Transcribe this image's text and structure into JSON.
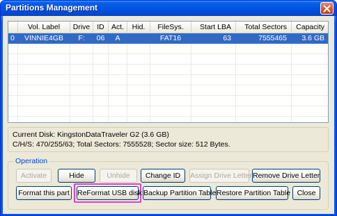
{
  "window": {
    "title": "Partitions Management"
  },
  "table": {
    "columns": [
      "",
      "Vol. Label",
      "Drive",
      "ID",
      "Act.",
      "Hid.",
      "FileSys.",
      "Start LBA",
      "Total Sectors",
      "Capacity"
    ],
    "rows": [
      [
        "0",
        "VINNIE4GB",
        "F:",
        "06",
        "A",
        "",
        "FAT16",
        "63",
        "7555465",
        "3.6 GB"
      ]
    ]
  },
  "info": {
    "current_disk": "Current Disk:  KingstonDataTraveler G2 (3.6 GB)",
    "chs": "C/H/S: 470/255/63; Total Sectors: 7555528; Sector size: 512 Bytes."
  },
  "operation": {
    "label": "Operation",
    "activate": "Activate",
    "hide": "Hide",
    "unhide": "Unhide",
    "change_id": "Change ID",
    "assign_drive_letter": "Assign Drive Letter",
    "remove_drive_letter": "Remove Drive Letter",
    "format_this_part": "Format this part",
    "reformat_usb": "ReFormat USB disk",
    "backup_table": "Backup Partition Table",
    "restore_table": "Restore Partition Table",
    "close": "Close"
  },
  "colors": {
    "title_bar": "#0054e3",
    "selection": "#316ac5",
    "highlight": "#e040d0"
  },
  "icons": {
    "close": "close-x-icon"
  }
}
